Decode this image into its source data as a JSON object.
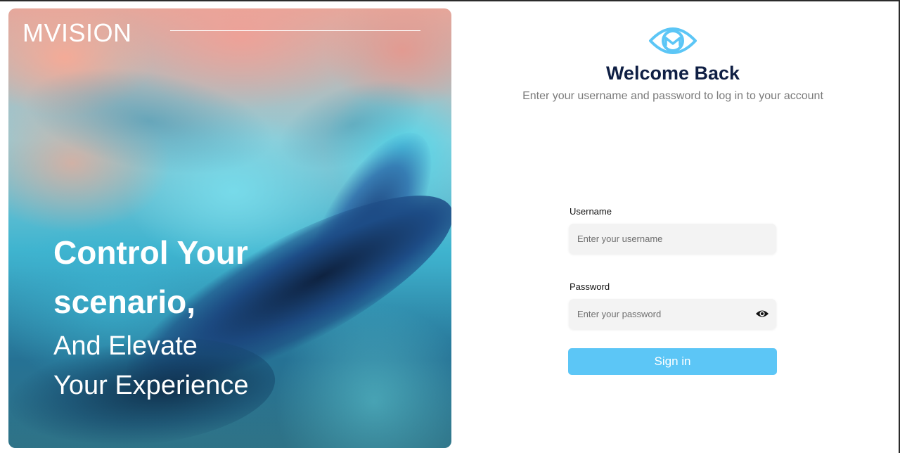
{
  "hero": {
    "brand": "MVISION",
    "headline_line1": "Control Your",
    "headline_line2": "scenario,",
    "subline_line1": "And Elevate",
    "subline_line2": "Your Experience"
  },
  "login": {
    "logo_icon": "eye-logo-icon",
    "title": "Welcome Back",
    "subtitle": "Enter your username and password to log in to your account",
    "username_label": "Username",
    "username_placeholder": "Enter your username",
    "username_value": "",
    "password_label": "Password",
    "password_placeholder": "Enter your password",
    "password_value": "",
    "password_toggle_icon": "eye-icon",
    "submit_label": "Sign in"
  },
  "colors": {
    "accent": "#5cc6f6",
    "title": "#0f1f44",
    "subtitle": "#7a7a7a",
    "field_bg": "#f3f3f3"
  }
}
